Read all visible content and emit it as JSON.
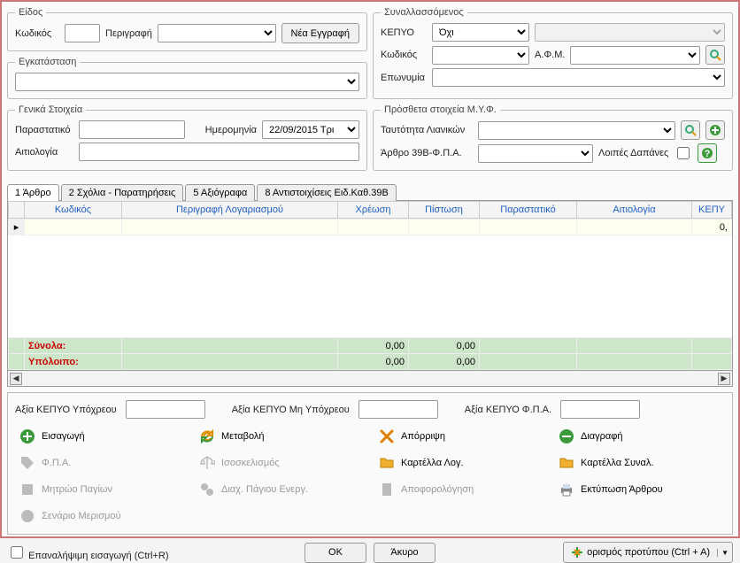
{
  "eidos": {
    "legend": "Είδος",
    "code_label": "Κωδικός",
    "code_value": "",
    "descr_label": "Περιγραφή",
    "descr_value": "",
    "new_btn": "Νέα Εγγραφή"
  },
  "installation": {
    "legend": "Εγκατάσταση",
    "value": ""
  },
  "counterparty": {
    "legend": "Συναλλασσόμενος",
    "kepyo_label": "ΚΕΠΥΟ",
    "kepyo_value": "Όχι",
    "code_label": "Κωδικός",
    "code_value": "",
    "afm_label": "Α.Φ.Μ.",
    "afm_value": "",
    "name_label": "Επωνυμία",
    "name_value": ""
  },
  "general": {
    "legend": "Γενικά Στοιχεία",
    "doc_label": "Παραστατικό",
    "doc_value": "",
    "date_label": "Ημερομηνία",
    "date_value": "22/09/2015 Τρι",
    "reason_label": "Αιτιολογία",
    "reason_value": ""
  },
  "myf": {
    "legend": "Πρόσθετα στοιχεία Μ.Υ.Φ.",
    "retail_label": "Ταυτότητα Λιανικών",
    "retail_value": "",
    "art39b_label": "Άρθρο 39Β-Φ.Π.Α.",
    "art39b_value": "",
    "other_exp_label": "Λοιπές Δαπάνες"
  },
  "tabs": {
    "t1": "1 Άρθρο",
    "t2": "2 Σχόλια - Παρατηρήσεις",
    "t3": "5 Αξιόγραφα",
    "t4": "8 Αντιστοιχίσεις Ειδ.Καθ.39Β"
  },
  "grid": {
    "cols": {
      "code": "Κωδικός",
      "descr": "Περιγραφή Λογαριασμού",
      "debit": "Χρέωση",
      "credit": "Πίστωση",
      "doc": "Παραστατικό",
      "reason": "Αιτιολογία",
      "kepyo": "ΚΕΠΥ"
    },
    "row1_kepyo": "0,",
    "totals_label": "Σύνολα:",
    "balance_label": "Υπόλοιπο:",
    "tot_debit": "0,00",
    "tot_credit": "0,00",
    "bal_debit": "0,00",
    "bal_credit": "0,00"
  },
  "kepyo_vals": {
    "liable_label": "Αξία ΚΕΠΥΟ Υπόχρεου",
    "liable_value": "",
    "nonliable_label": "Αξία ΚΕΠΥΟ Μη Υπόχρεου",
    "nonliable_value": "",
    "fpa_label": "Αξία ΚΕΠΥΟ Φ.Π.Α.",
    "fpa_value": ""
  },
  "actions": {
    "insert": "Εισαγωγή",
    "modify": "Μεταβολή",
    "reject": "Απόρριψη",
    "delete": "Διαγραφή",
    "fpa": "Φ.Π.Α.",
    "balance": "Ισοσκελισμός",
    "card_acc": "Καρτέλλα Λογ.",
    "card_party": "Καρτέλλα Συναλ.",
    "fixed_reg": "Μητρώο Παγίων",
    "fixed_mgmt": "Διαχ. Πάγιου Ενεργ.",
    "detax": "Αποφορολόγηση",
    "print": "Εκτύπωση Άρθρου",
    "split": "Σενάριο Μερισμού"
  },
  "bottom": {
    "repeat_label": "Επαναλήψιμη εισαγωγή (Ctrl+R)",
    "ok": "OK",
    "cancel": "Άκυρο",
    "template": "ορισμός προτύπου (Ctrl + A)"
  }
}
